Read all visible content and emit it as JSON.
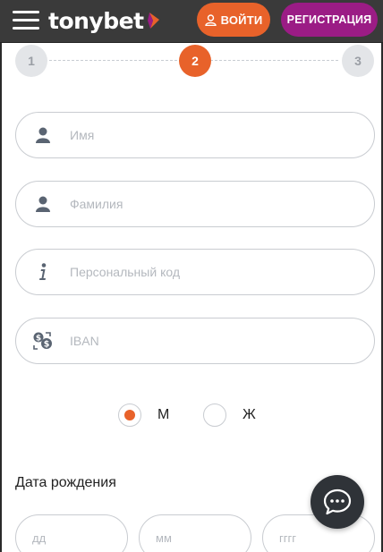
{
  "header": {
    "brand": "tonybet",
    "login_label": "ВОЙТИ",
    "register_label": "РЕГИСТРАЦИЯ",
    "colors": {
      "bar": "#3a3a3a",
      "login": "#e8622a",
      "register": "#9b1c85"
    }
  },
  "steps": [
    {
      "label": "1",
      "state": "inactive"
    },
    {
      "label": "2",
      "state": "active"
    },
    {
      "label": "3",
      "state": "inactive"
    }
  ],
  "form": {
    "first_name": {
      "icon": "user-icon",
      "placeholder": "Имя",
      "value": ""
    },
    "last_name": {
      "icon": "user-icon",
      "placeholder": "Фамилия",
      "value": ""
    },
    "personal_code": {
      "icon": "info-icon",
      "placeholder": "Персональный код",
      "value": ""
    },
    "iban": {
      "icon": "money-exchange-icon",
      "placeholder": "IBAN",
      "value": ""
    },
    "gender": {
      "options": [
        {
          "label": "М",
          "selected": true
        },
        {
          "label": "Ж",
          "selected": false
        }
      ]
    },
    "dob": {
      "label": "Дата рождения",
      "day_placeholder": "дд",
      "month_placeholder": "мм",
      "year_placeholder": "гггг"
    }
  },
  "chat": {
    "icon": "chat-bubble-icon"
  },
  "accent": "#e8622a"
}
